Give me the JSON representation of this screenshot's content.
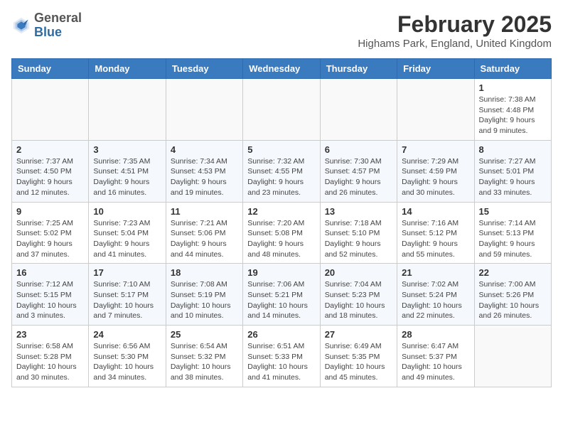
{
  "header": {
    "logo_general": "General",
    "logo_blue": "Blue",
    "month_title": "February 2025",
    "location": "Highams Park, England, United Kingdom"
  },
  "days_of_week": [
    "Sunday",
    "Monday",
    "Tuesday",
    "Wednesday",
    "Thursday",
    "Friday",
    "Saturday"
  ],
  "weeks": [
    [
      {
        "day": "",
        "info": ""
      },
      {
        "day": "",
        "info": ""
      },
      {
        "day": "",
        "info": ""
      },
      {
        "day": "",
        "info": ""
      },
      {
        "day": "",
        "info": ""
      },
      {
        "day": "",
        "info": ""
      },
      {
        "day": "1",
        "info": "Sunrise: 7:38 AM\nSunset: 4:48 PM\nDaylight: 9 hours and 9 minutes."
      }
    ],
    [
      {
        "day": "2",
        "info": "Sunrise: 7:37 AM\nSunset: 4:50 PM\nDaylight: 9 hours and 12 minutes."
      },
      {
        "day": "3",
        "info": "Sunrise: 7:35 AM\nSunset: 4:51 PM\nDaylight: 9 hours and 16 minutes."
      },
      {
        "day": "4",
        "info": "Sunrise: 7:34 AM\nSunset: 4:53 PM\nDaylight: 9 hours and 19 minutes."
      },
      {
        "day": "5",
        "info": "Sunrise: 7:32 AM\nSunset: 4:55 PM\nDaylight: 9 hours and 23 minutes."
      },
      {
        "day": "6",
        "info": "Sunrise: 7:30 AM\nSunset: 4:57 PM\nDaylight: 9 hours and 26 minutes."
      },
      {
        "day": "7",
        "info": "Sunrise: 7:29 AM\nSunset: 4:59 PM\nDaylight: 9 hours and 30 minutes."
      },
      {
        "day": "8",
        "info": "Sunrise: 7:27 AM\nSunset: 5:01 PM\nDaylight: 9 hours and 33 minutes."
      }
    ],
    [
      {
        "day": "9",
        "info": "Sunrise: 7:25 AM\nSunset: 5:02 PM\nDaylight: 9 hours and 37 minutes."
      },
      {
        "day": "10",
        "info": "Sunrise: 7:23 AM\nSunset: 5:04 PM\nDaylight: 9 hours and 41 minutes."
      },
      {
        "day": "11",
        "info": "Sunrise: 7:21 AM\nSunset: 5:06 PM\nDaylight: 9 hours and 44 minutes."
      },
      {
        "day": "12",
        "info": "Sunrise: 7:20 AM\nSunset: 5:08 PM\nDaylight: 9 hours and 48 minutes."
      },
      {
        "day": "13",
        "info": "Sunrise: 7:18 AM\nSunset: 5:10 PM\nDaylight: 9 hours and 52 minutes."
      },
      {
        "day": "14",
        "info": "Sunrise: 7:16 AM\nSunset: 5:12 PM\nDaylight: 9 hours and 55 minutes."
      },
      {
        "day": "15",
        "info": "Sunrise: 7:14 AM\nSunset: 5:13 PM\nDaylight: 9 hours and 59 minutes."
      }
    ],
    [
      {
        "day": "16",
        "info": "Sunrise: 7:12 AM\nSunset: 5:15 PM\nDaylight: 10 hours and 3 minutes."
      },
      {
        "day": "17",
        "info": "Sunrise: 7:10 AM\nSunset: 5:17 PM\nDaylight: 10 hours and 7 minutes."
      },
      {
        "day": "18",
        "info": "Sunrise: 7:08 AM\nSunset: 5:19 PM\nDaylight: 10 hours and 10 minutes."
      },
      {
        "day": "19",
        "info": "Sunrise: 7:06 AM\nSunset: 5:21 PM\nDaylight: 10 hours and 14 minutes."
      },
      {
        "day": "20",
        "info": "Sunrise: 7:04 AM\nSunset: 5:23 PM\nDaylight: 10 hours and 18 minutes."
      },
      {
        "day": "21",
        "info": "Sunrise: 7:02 AM\nSunset: 5:24 PM\nDaylight: 10 hours and 22 minutes."
      },
      {
        "day": "22",
        "info": "Sunrise: 7:00 AM\nSunset: 5:26 PM\nDaylight: 10 hours and 26 minutes."
      }
    ],
    [
      {
        "day": "23",
        "info": "Sunrise: 6:58 AM\nSunset: 5:28 PM\nDaylight: 10 hours and 30 minutes."
      },
      {
        "day": "24",
        "info": "Sunrise: 6:56 AM\nSunset: 5:30 PM\nDaylight: 10 hours and 34 minutes."
      },
      {
        "day": "25",
        "info": "Sunrise: 6:54 AM\nSunset: 5:32 PM\nDaylight: 10 hours and 38 minutes."
      },
      {
        "day": "26",
        "info": "Sunrise: 6:51 AM\nSunset: 5:33 PM\nDaylight: 10 hours and 41 minutes."
      },
      {
        "day": "27",
        "info": "Sunrise: 6:49 AM\nSunset: 5:35 PM\nDaylight: 10 hours and 45 minutes."
      },
      {
        "day": "28",
        "info": "Sunrise: 6:47 AM\nSunset: 5:37 PM\nDaylight: 10 hours and 49 minutes."
      },
      {
        "day": "",
        "info": ""
      }
    ]
  ]
}
